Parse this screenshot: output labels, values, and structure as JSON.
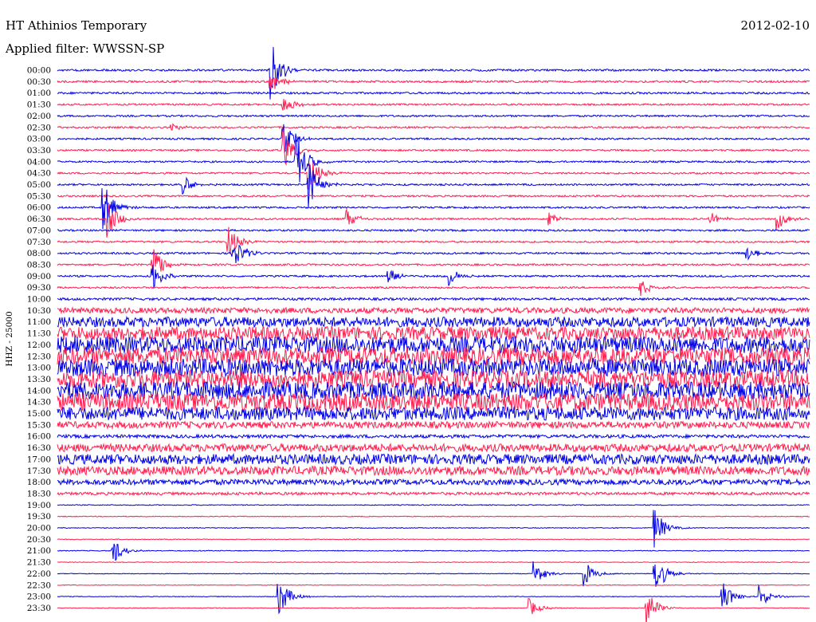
{
  "header": {
    "station": "HT Athinios Temporary",
    "date": "2012-02-10",
    "filter": "Applied filter: WWSSN-SP"
  },
  "colors": {
    "odd": "#0000e6",
    "even": "#ff1e4f"
  },
  "chart_data": {
    "type": "line",
    "title": "HT Athinios Temporary",
    "subtitle": "Applied filter: WWSSN-SP",
    "date": "2012-02-10",
    "ylabel": "HHZ - 25000",
    "xlabel": "",
    "trace_labels": [
      "00:00",
      "00:30",
      "01:00",
      "01:30",
      "02:00",
      "02:30",
      "03:00",
      "03:30",
      "04:00",
      "04:30",
      "05:00",
      "05:30",
      "06:00",
      "06:30",
      "07:00",
      "07:30",
      "08:00",
      "08:30",
      "09:00",
      "09:30",
      "10:00",
      "10:30",
      "11:00",
      "11:30",
      "12:00",
      "12:30",
      "13:00",
      "13:30",
      "14:00",
      "14:30",
      "15:00",
      "15:30",
      "16:00",
      "16:30",
      "17:00",
      "17:30",
      "18:00",
      "18:30",
      "19:00",
      "19:30",
      "20:00",
      "20:30",
      "21:00",
      "21:30",
      "22:00",
      "22:30",
      "23:00",
      "23:30"
    ],
    "trace_minutes": 30,
    "legend": "none",
    "grid": false,
    "noise_levels": [
      0.18,
      0.18,
      0.18,
      0.16,
      0.16,
      0.16,
      0.16,
      0.16,
      0.16,
      0.16,
      0.16,
      0.16,
      0.16,
      0.16,
      0.16,
      0.16,
      0.16,
      0.16,
      0.16,
      0.16,
      0.22,
      0.5,
      0.9,
      1.2,
      1.5,
      1.6,
      1.6,
      1.6,
      1.6,
      1.6,
      1.2,
      0.6,
      0.3,
      0.7,
      0.9,
      0.8,
      0.5,
      0.25,
      0.08,
      0.07,
      0.07,
      0.07,
      0.07,
      0.06,
      0.06,
      0.06,
      0.06,
      0.06
    ],
    "events": [
      {
        "trace": 0,
        "minute": 8.5,
        "amp": 2.2
      },
      {
        "trace": 1,
        "minute": 8.5,
        "amp": 1.0
      },
      {
        "trace": 3,
        "minute": 9.0,
        "amp": 0.8
      },
      {
        "trace": 5,
        "minute": 4.5,
        "amp": 0.4
      },
      {
        "trace": 6,
        "minute": 9.0,
        "amp": 1.2
      },
      {
        "trace": 7,
        "minute": 9.0,
        "amp": 1.6
      },
      {
        "trace": 8,
        "minute": 9.5,
        "amp": 2.5
      },
      {
        "trace": 9,
        "minute": 10.0,
        "amp": 1.5
      },
      {
        "trace": 10,
        "minute": 10.0,
        "amp": 1.8
      },
      {
        "trace": 10,
        "minute": 5.0,
        "amp": 0.8
      },
      {
        "trace": 12,
        "minute": 1.8,
        "amp": 2.0
      },
      {
        "trace": 13,
        "minute": 2.0,
        "amp": 1.5
      },
      {
        "trace": 13,
        "minute": 11.5,
        "amp": 0.8
      },
      {
        "trace": 13,
        "minute": 19.6,
        "amp": 0.6
      },
      {
        "trace": 13,
        "minute": 26.0,
        "amp": 0.6
      },
      {
        "trace": 13,
        "minute": 28.7,
        "amp": 0.8
      },
      {
        "trace": 15,
        "minute": 6.8,
        "amp": 1.2
      },
      {
        "trace": 16,
        "minute": 7.0,
        "amp": 1.4
      },
      {
        "trace": 16,
        "minute": 27.5,
        "amp": 0.6
      },
      {
        "trace": 17,
        "minute": 3.8,
        "amp": 1.6
      },
      {
        "trace": 18,
        "minute": 3.8,
        "amp": 1.0
      },
      {
        "trace": 18,
        "minute": 13.2,
        "amp": 0.7
      },
      {
        "trace": 18,
        "minute": 15.6,
        "amp": 0.7
      },
      {
        "trace": 19,
        "minute": 23.2,
        "amp": 0.7
      },
      {
        "trace": 40,
        "minute": 23.8,
        "amp": 1.5
      },
      {
        "trace": 42,
        "minute": 2.2,
        "amp": 1.0
      },
      {
        "trace": 44,
        "minute": 19.0,
        "amp": 0.9
      },
      {
        "trace": 44,
        "minute": 21.0,
        "amp": 1.0
      },
      {
        "trace": 44,
        "minute": 23.8,
        "amp": 1.8
      },
      {
        "trace": 46,
        "minute": 8.8,
        "amp": 1.6
      },
      {
        "trace": 46,
        "minute": 26.5,
        "amp": 1.2
      },
      {
        "trace": 46,
        "minute": 28.0,
        "amp": 0.8
      },
      {
        "trace": 47,
        "minute": 18.8,
        "amp": 0.7
      },
      {
        "trace": 47,
        "minute": 23.5,
        "amp": 1.3
      }
    ]
  }
}
